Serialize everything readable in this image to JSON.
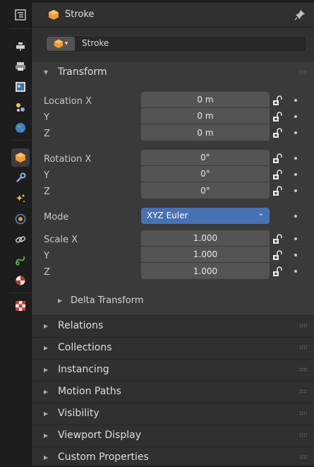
{
  "header": {
    "title": "Stroke",
    "icon": "object-data-icon",
    "pin_icon": "pin-icon"
  },
  "selector": {
    "name": "Stroke",
    "icon": "object-data-icon"
  },
  "sidebar": {
    "items": [
      {
        "name": "tool-icon"
      },
      {
        "name": "render-icon"
      },
      {
        "name": "output-icon"
      },
      {
        "name": "view-layer-icon"
      },
      {
        "name": "scene-icon"
      },
      {
        "name": "world-icon"
      },
      {
        "name": "object-icon",
        "active": true
      },
      {
        "name": "modifiers-icon"
      },
      {
        "name": "shader-effects-icon"
      },
      {
        "name": "physics-icon"
      },
      {
        "name": "constraints-icon"
      },
      {
        "name": "object-data-icon"
      },
      {
        "name": "material-icon"
      },
      {
        "name": "texture-icon"
      }
    ]
  },
  "transform": {
    "title": "Transform",
    "location": {
      "label": "Location X",
      "y_label": "Y",
      "z_label": "Z",
      "x": "0 m",
      "y": "0 m",
      "z": "0 m"
    },
    "rotation": {
      "label": "Rotation X",
      "y_label": "Y",
      "z_label": "Z",
      "x": "0°",
      "y": "0°",
      "z": "0°"
    },
    "mode": {
      "label": "Mode",
      "value": "XYZ Euler"
    },
    "scale": {
      "label": "Scale X",
      "y_label": "Y",
      "z_label": "Z",
      "x": "1.000",
      "y": "1.000",
      "z": "1.000"
    },
    "delta": "Delta Transform"
  },
  "sections": [
    "Relations",
    "Collections",
    "Instancing",
    "Motion Paths",
    "Visibility",
    "Viewport Display",
    "Custom Properties"
  ],
  "colors": {
    "accent": "#4772b3",
    "object_orange": "#f29a2e"
  }
}
